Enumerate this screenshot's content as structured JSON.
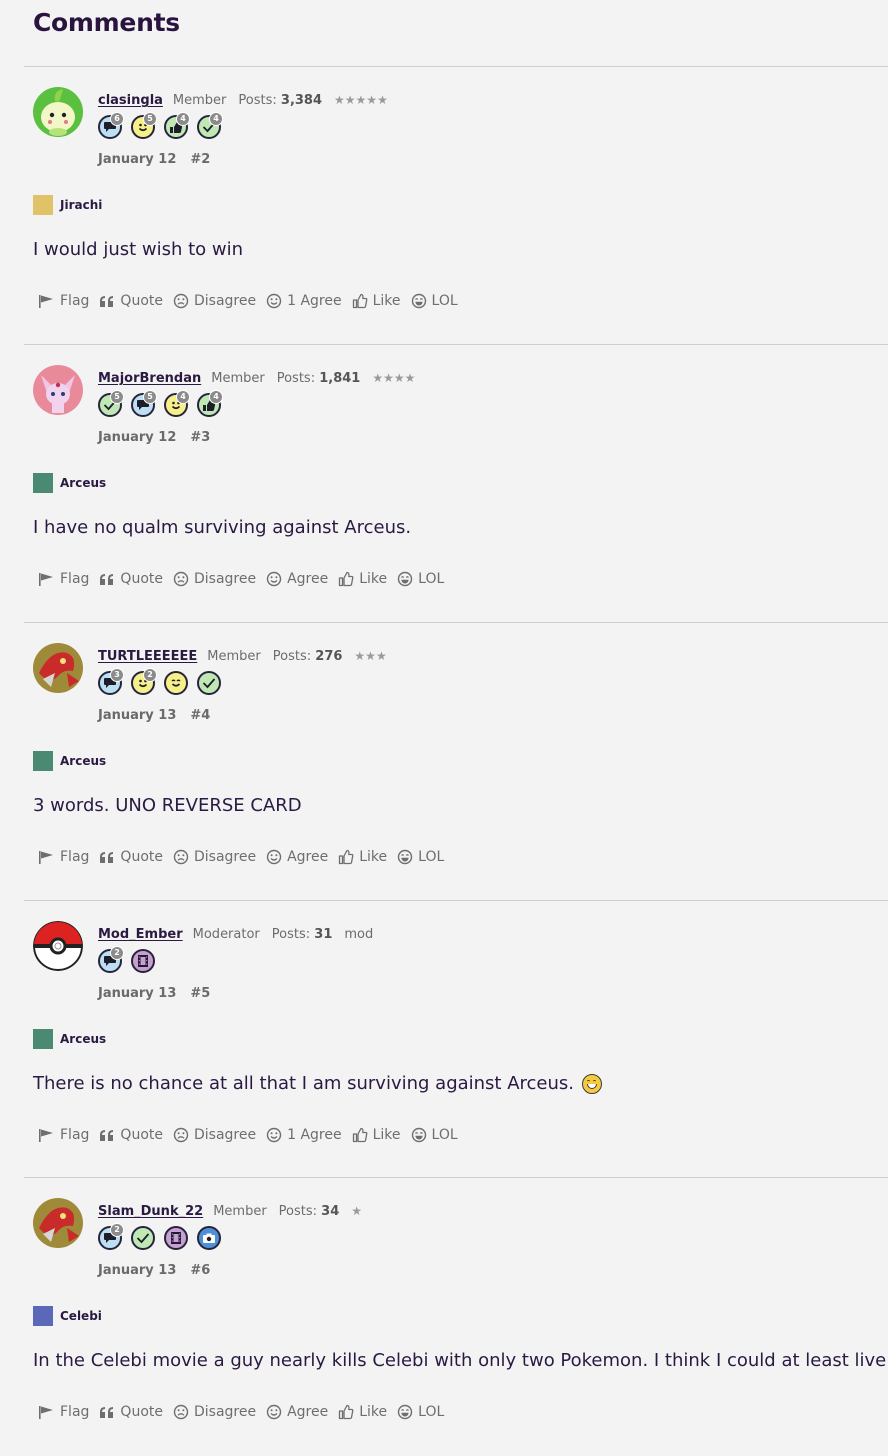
{
  "page": {
    "heading": "Comments"
  },
  "comments": [
    {
      "username": "clasingla",
      "role": "Member",
      "posts_label": "Posts:",
      "posts_count": "3,384",
      "stars": "★★★★★",
      "avatar": "chikorita",
      "badges": [
        {
          "icon": "speech-bubble-icon",
          "color": "#bcdff4",
          "level": "6"
        },
        {
          "icon": "smiley-icon",
          "color": "#f6f089",
          "level": "5"
        },
        {
          "icon": "thumbs-up-icon",
          "color": "#bfe8b5",
          "level": "4"
        },
        {
          "icon": "checkmark-icon",
          "color": "#bfe8b5",
          "level": "4"
        }
      ],
      "date": "January 12",
      "number": "#2",
      "category": "Jirachi",
      "category_color": "#e0c268",
      "body": "I would just wish to win",
      "emoji": false,
      "actions": {
        "flag": "Flag",
        "quote": "Quote",
        "disagree": "Disagree",
        "agree": "1 Agree",
        "like": "Like",
        "lol": "LOL"
      }
    },
    {
      "username": "MajorBrendan",
      "role": "Member",
      "posts_label": "Posts:",
      "posts_count": "1,841",
      "stars": "★★★★",
      "avatar": "espeon",
      "badges": [
        {
          "icon": "checkmark-icon",
          "color": "#bfe8b5",
          "level": "5"
        },
        {
          "icon": "speech-bubble-icon",
          "color": "#bcdff4",
          "level": "5"
        },
        {
          "icon": "smiley-icon",
          "color": "#f6f089",
          "level": "4"
        },
        {
          "icon": "thumbs-up-icon",
          "color": "#bfe8b5",
          "level": "4"
        }
      ],
      "date": "January 12",
      "number": "#3",
      "category": "Arceus",
      "category_color": "#4a8a72",
      "body": "I have no qualm surviving against Arceus.",
      "emoji": false,
      "actions": {
        "flag": "Flag",
        "quote": "Quote",
        "disagree": "Disagree",
        "agree": "Agree",
        "like": "Like",
        "lol": "LOL"
      }
    },
    {
      "username": "TURTLEEEEEE",
      "role": "Member",
      "posts_label": "Posts:",
      "posts_count": "276",
      "stars": "★★★",
      "avatar": "scizor",
      "badges": [
        {
          "icon": "speech-bubble-icon",
          "color": "#bcdff4",
          "level": "3"
        },
        {
          "icon": "smiley-icon",
          "color": "#f6f089",
          "level": "2"
        },
        {
          "icon": "wink-icon",
          "color": "#f6f089",
          "level": ""
        },
        {
          "icon": "checkmark-icon",
          "color": "#bfe8b5",
          "level": ""
        }
      ],
      "date": "January 13",
      "number": "#4",
      "category": "Arceus",
      "category_color": "#4a8a72",
      "body": "3 words. UNO REVERSE CARD",
      "emoji": false,
      "actions": {
        "flag": "Flag",
        "quote": "Quote",
        "disagree": "Disagree",
        "agree": "Agree",
        "like": "Like",
        "lol": "LOL"
      }
    },
    {
      "username": "Mod_Ember",
      "role": "Moderator",
      "posts_label": "Posts:",
      "posts_count": "31",
      "stars": "mod",
      "avatar": "pokeball",
      "badges": [
        {
          "icon": "speech-bubble-icon",
          "color": "#bcdff4",
          "level": "2"
        },
        {
          "icon": "film-icon",
          "color": "#c89ed4",
          "level": ""
        }
      ],
      "date": "January 13",
      "number": "#5",
      "category": "Arceus",
      "category_color": "#4a8a72",
      "body": "There is no chance at all that I am surviving against Arceus.",
      "emoji": true,
      "actions": {
        "flag": "Flag",
        "quote": "Quote",
        "disagree": "Disagree",
        "agree": "1 Agree",
        "like": "Like",
        "lol": "LOL"
      }
    },
    {
      "username": "Slam_Dunk_22",
      "role": "Member",
      "posts_label": "Posts:",
      "posts_count": "34",
      "stars": "★",
      "avatar": "scizor",
      "badges": [
        {
          "icon": "speech-bubble-icon",
          "color": "#bcdff4",
          "level": "2"
        },
        {
          "icon": "checkmark-icon",
          "color": "#bfe8b5",
          "level": ""
        },
        {
          "icon": "film-icon",
          "color": "#c89ed4",
          "level": ""
        },
        {
          "icon": "camera-icon",
          "color": "#4f8fd8",
          "level": ""
        }
      ],
      "date": "January 13",
      "number": "#6",
      "category": "Celebi",
      "category_color": "#5b67b8",
      "body": "In the Celebi movie a guy nearly kills Celebi with only two Pokemon. I think I could at least live.",
      "emoji": false,
      "actions": {
        "flag": "Flag",
        "quote": "Quote",
        "disagree": "Disagree",
        "agree": "Agree",
        "like": "Like",
        "lol": "LOL"
      }
    }
  ]
}
